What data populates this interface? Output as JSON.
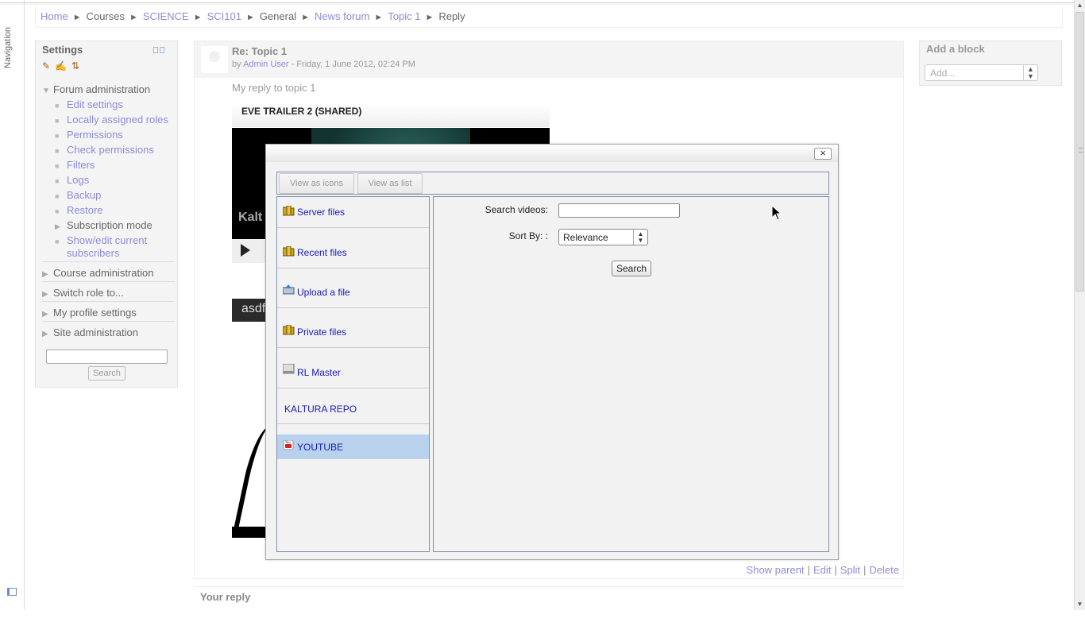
{
  "navigation": {
    "label": "Navigation"
  },
  "breadcrumb": {
    "items": [
      {
        "label": "Home",
        "link": true
      },
      {
        "label": "Courses",
        "link": false
      },
      {
        "label": "SCIENCE",
        "link": true
      },
      {
        "label": "SCI101",
        "link": true
      },
      {
        "label": "General",
        "link": false
      },
      {
        "label": "News forum",
        "link": true
      },
      {
        "label": "Topic 1",
        "link": true
      },
      {
        "label": "Reply",
        "link": false
      }
    ],
    "separator": "►"
  },
  "settings": {
    "title": "Settings",
    "forum_admin": "Forum administration",
    "forum_items": [
      "Edit settings",
      "Locally assigned roles",
      "Permissions",
      "Check permissions",
      "Filters",
      "Logs",
      "Backup",
      "Restore"
    ],
    "subscription_mode": "Subscription mode",
    "show_edit_subscribers_line1": "Show/edit current",
    "show_edit_subscribers_line2": "subscribers",
    "course_admin": "Course administration",
    "switch_role": "Switch role to...",
    "my_profile": "My profile settings",
    "site_admin": "Site administration",
    "search_button": "Search"
  },
  "add_block": {
    "title": "Add a block",
    "select_placeholder": "Add..."
  },
  "post": {
    "subject": "Re: Topic 1",
    "by": "by",
    "author": "Admin User",
    "date": "- Friday, 1 June 2012, 02:24 PM",
    "message": "My reply to topic 1",
    "video_title": "EVE TRAILER 2 (SHARED)",
    "video_brand": "Kalt",
    "embed2_title": "asdf",
    "commands": [
      "Show parent",
      "Edit",
      "Split",
      "Delete"
    ]
  },
  "your_reply": {
    "label": "Your reply"
  },
  "dialog": {
    "close": "×",
    "view_icons": "View as icons",
    "view_list": "View as list",
    "repositories": [
      {
        "label": "Server files",
        "icon": "server-files-icon"
      },
      {
        "label": "Recent files",
        "icon": "recent-files-icon"
      },
      {
        "label": "Upload a file",
        "icon": "upload-icon"
      },
      {
        "label": "Private files",
        "icon": "private-files-icon"
      },
      {
        "label": "RL Master",
        "icon": "rl-master-icon"
      },
      {
        "label": "KALTURA REPO",
        "icon": ""
      },
      {
        "label": "YOUTUBE",
        "icon": "youtube-icon"
      }
    ],
    "selected_repository": "YOUTUBE",
    "search_videos_label": "Search videos:",
    "search_videos_value": "",
    "sort_by_label": "Sort By: :",
    "sort_by_value": "Relevance",
    "search_button": "Search"
  },
  "colors": {
    "link": "#8c8cd9",
    "dialog_link": "#1a1ab8",
    "selected_repo_bg": "#b8d1ec"
  }
}
